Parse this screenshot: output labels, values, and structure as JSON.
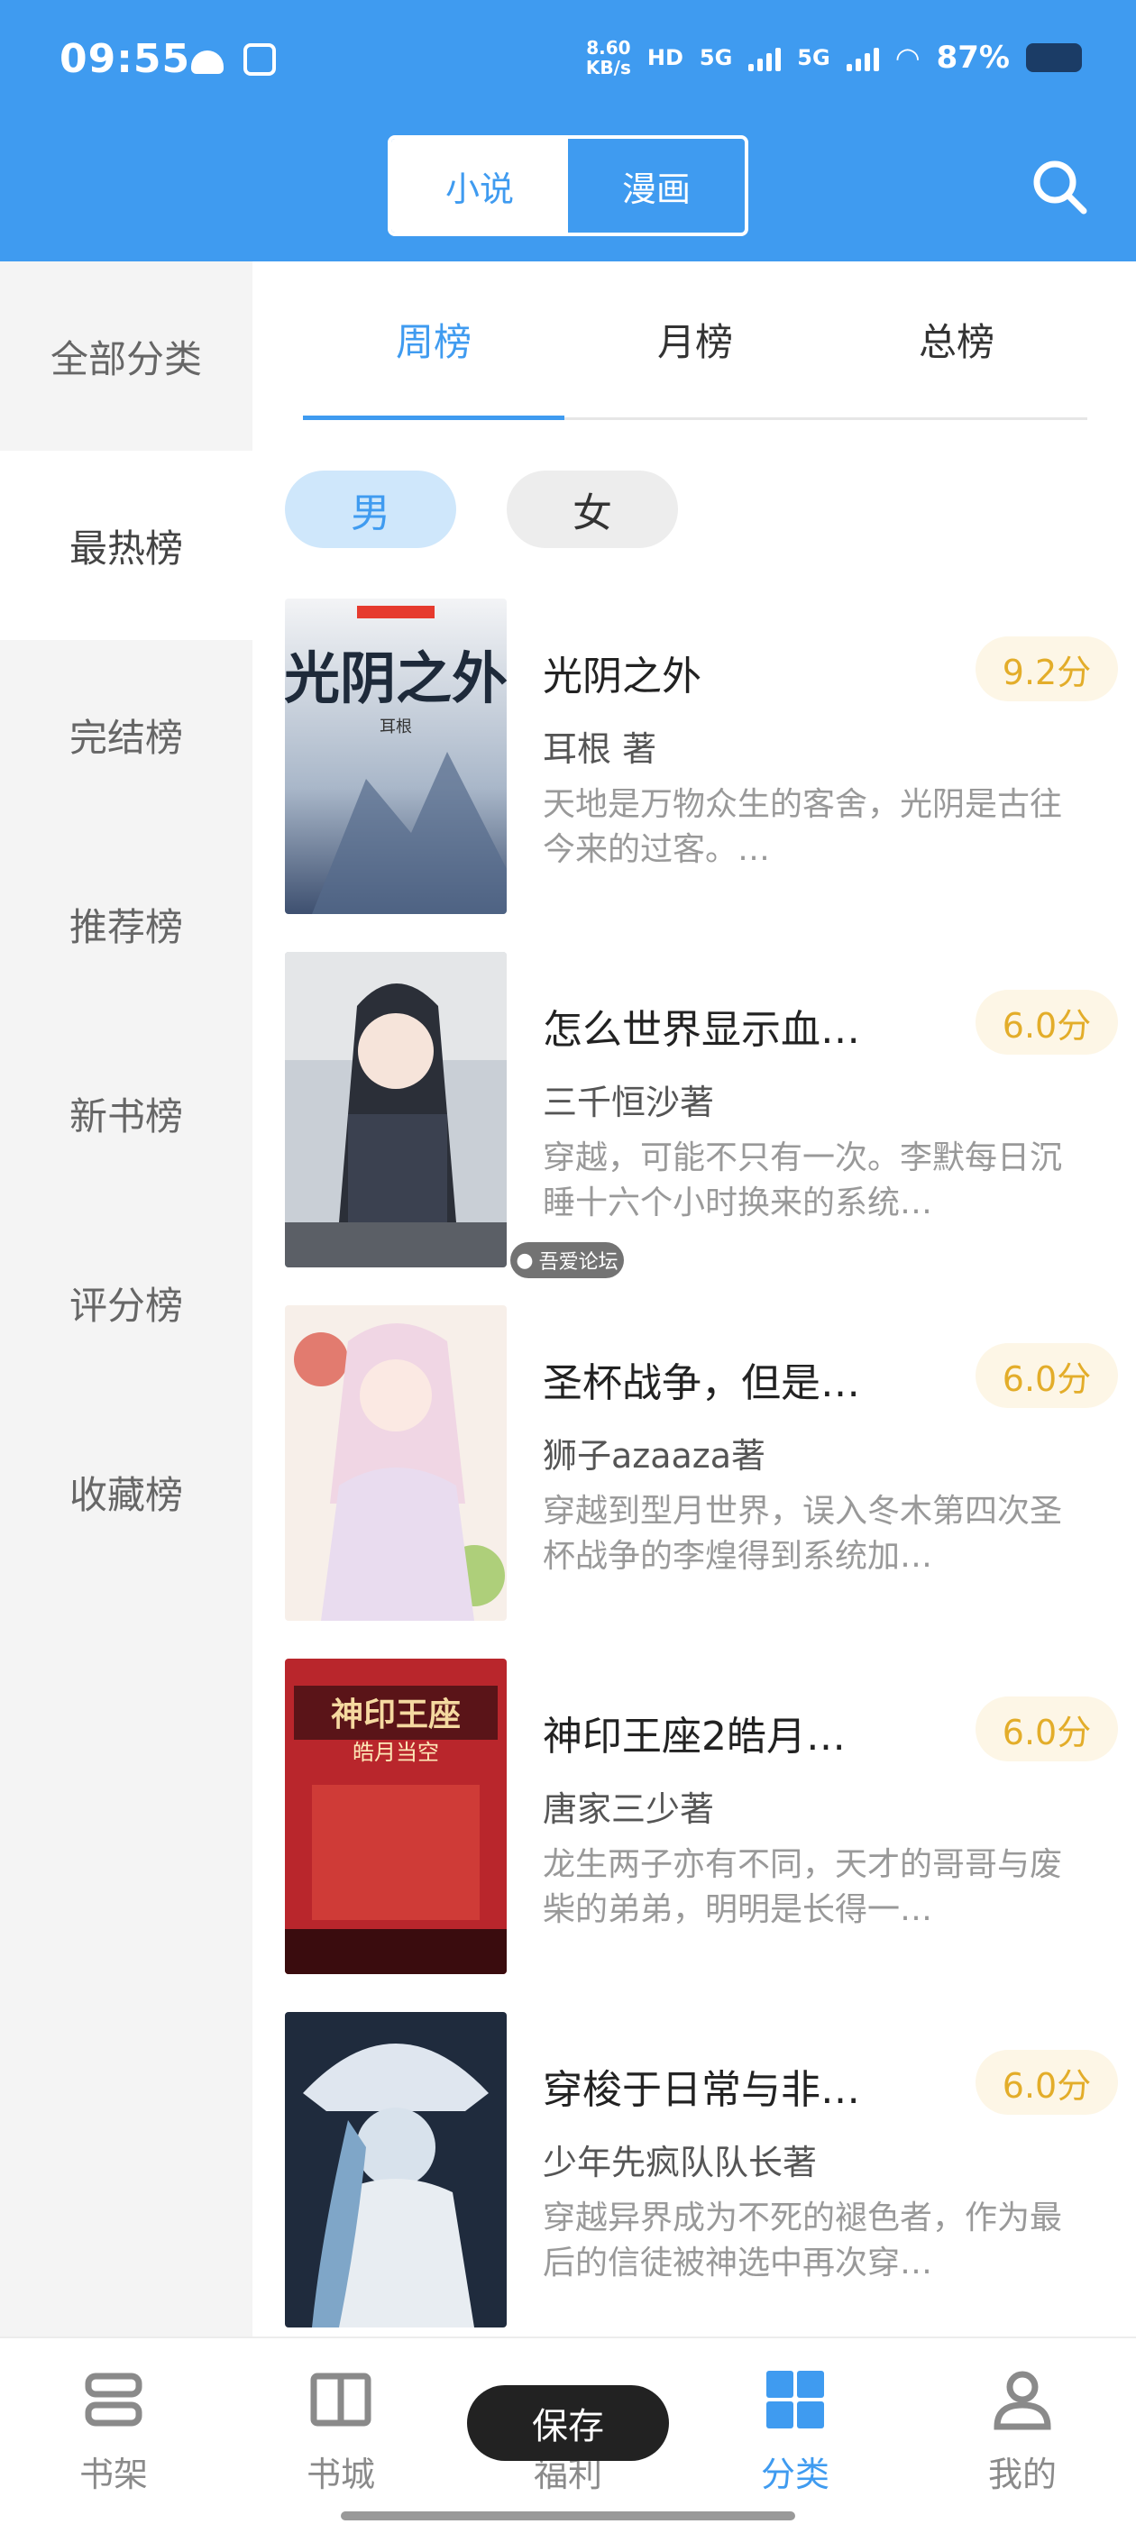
{
  "status_bar": {
    "time": "09:55",
    "net_speed_value": "8.60",
    "net_speed_unit": "KB/s",
    "hd": "HD",
    "sim1": "5G",
    "sim2": "5G",
    "battery": "87%"
  },
  "header": {
    "segments": [
      "小说",
      "漫画"
    ],
    "active_segment": "小说",
    "search_icon": "search-icon",
    "bg_color": "#3f9bf0"
  },
  "sidebar": {
    "items": [
      "全部分类",
      "最热榜",
      "完结榜",
      "推荐榜",
      "新书榜",
      "评分榜",
      "收藏榜"
    ],
    "active": "最热榜"
  },
  "tabs": {
    "items": [
      "周榜",
      "月榜",
      "总榜"
    ],
    "active": "周榜"
  },
  "gender": {
    "items": [
      "男",
      "女"
    ],
    "active": "男"
  },
  "books": [
    {
      "title": "光阴之外",
      "score": "9.2分",
      "author": "耳根 著",
      "desc": "天地是万物众生的客舍，光阴是古往今来的过客。…"
    },
    {
      "title": "怎么世界显示血…",
      "score": "6.0分",
      "author": "三千恒沙著",
      "desc": "穿越，可能不只有一次。李默每日沉睡十六个小时换来的系统…"
    },
    {
      "title": "圣杯战争，但是…",
      "score": "6.0分",
      "author": "狮子azaaza著",
      "desc": "穿越到型月世界，误入冬木第四次圣杯战争的李煌得到系统加…"
    },
    {
      "title": "神印王座2皓月…",
      "score": "6.0分",
      "author": "唐家三少著",
      "desc": "龙生两子亦有不同，天才的哥哥与废柴的弟弟，明明是长得一…"
    },
    {
      "title": "穿梭于日常与非…",
      "score": "6.0分",
      "author": "少年先疯队队长著",
      "desc": "穿越异界成为不死的褪色者，作为最后的信徒被神选中再次穿…"
    }
  ],
  "cover_texts": {
    "book1_title": "光阴之外",
    "book1_author": "耳根",
    "book4_title": "神印王座",
    "book4_sub": "皓月当空"
  },
  "watermark": "吾爱论坛",
  "toast": "保存",
  "bottom_nav": {
    "items": [
      "书架",
      "书城",
      "福利",
      "分类",
      "我的"
    ],
    "active": "分类"
  }
}
